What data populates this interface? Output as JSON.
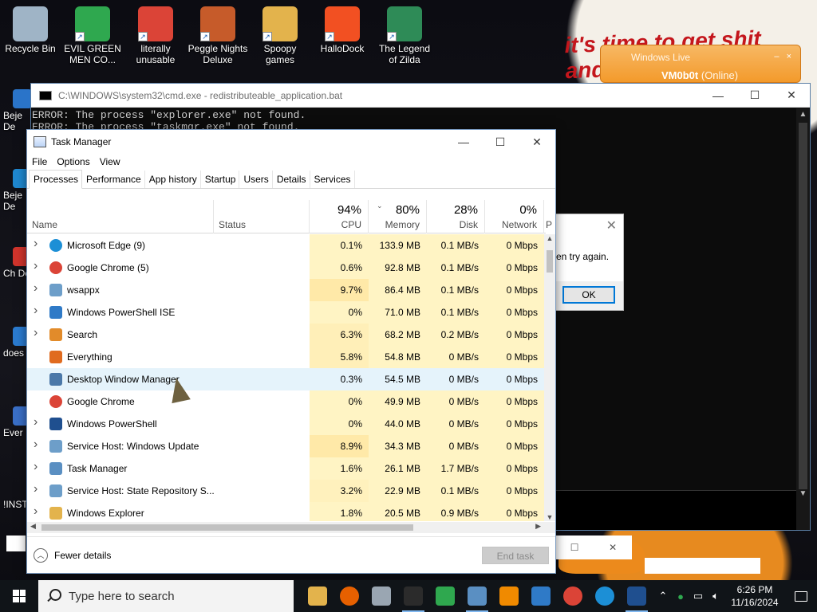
{
  "wallpaper": {
    "meme_text": "it's time to get shit and"
  },
  "desktop_icons": [
    {
      "label": "Recycle Bin",
      "icon": "recycle-bin-icon",
      "color": "#9fb4c6"
    },
    {
      "label": "EVIL GREEN MEN CO...",
      "icon": "msn-buddies-icon",
      "color": "#2fa84f"
    },
    {
      "label": "literally unusable",
      "icon": "chrome-icon",
      "color": "#db4437"
    },
    {
      "label": "Peggle Nights Deluxe",
      "icon": "peggle-icon",
      "color": "#c65b2a"
    },
    {
      "label": "Spoopy games",
      "icon": "folder-icon",
      "color": "#e3b34c"
    },
    {
      "label": "HalloDock",
      "icon": "windows-logo-icon",
      "color": "#f25022"
    },
    {
      "label": "The Legend of Zilda",
      "icon": "zelda-character-icon",
      "color": "#2e8b57"
    }
  ],
  "side_icons": [
    "Beje De",
    "Beje De",
    "Ch De",
    "does",
    "Ever",
    "!INST"
  ],
  "cmd_window": {
    "title": "C:\\WINDOWS\\system32\\cmd.exe - redistributeable_application.bat",
    "lines": [
      "ERROR: The process \"explorer.exe\" not found.",
      "ERROR: The process \"taskmgr.exe\" not found."
    ]
  },
  "wlm_popup": {
    "title": "Windows Live Messenger",
    "title_visible": "Windows Live",
    "username": "VM0b0t",
    "status": "(Online)"
  },
  "error_dialog": {
    "message": "en try again.",
    "ok_label": "OK"
  },
  "task_manager": {
    "title": "Task Manager",
    "menu": [
      "File",
      "Options",
      "View"
    ],
    "tabs": [
      "Processes",
      "Performance",
      "App history",
      "Startup",
      "Users",
      "Details",
      "Services"
    ],
    "active_tab": "Processes",
    "columns": {
      "name": "Name",
      "status": "Status",
      "cpu": {
        "pct": "94%",
        "label": "CPU"
      },
      "memory": {
        "pct": "80%",
        "label": "Memory"
      },
      "disk": {
        "pct": "28%",
        "label": "Disk"
      },
      "network": {
        "pct": "0%",
        "label": "Network"
      },
      "power": "P"
    },
    "processes": [
      {
        "name": "Microsoft Edge (9)",
        "expandable": true,
        "icon": "edge-icon",
        "icon_color": "#1c8fd6",
        "cpu": "0.1%",
        "memory": "133.9 MB",
        "disk": "0.1 MB/s",
        "network": "0 Mbps",
        "cpu_shade": "#fff4c4"
      },
      {
        "name": "Google Chrome (5)",
        "expandable": true,
        "icon": "chrome-icon",
        "icon_color": "#db4437",
        "cpu": "0.6%",
        "memory": "92.8 MB",
        "disk": "0.1 MB/s",
        "network": "0 Mbps",
        "cpu_shade": "#fff4c4"
      },
      {
        "name": "wsappx",
        "expandable": true,
        "icon": "gear-icon",
        "icon_color": "#6d9ec9",
        "cpu": "9.7%",
        "memory": "86.4 MB",
        "disk": "0.1 MB/s",
        "network": "0 Mbps",
        "cpu_shade": "#ffe9a8"
      },
      {
        "name": "Windows PowerShell ISE",
        "expandable": true,
        "icon": "powershell-ise-icon",
        "icon_color": "#2f7ac7",
        "cpu": "0%",
        "memory": "71.0 MB",
        "disk": "0.1 MB/s",
        "network": "0 Mbps",
        "cpu_shade": "#fff4c4"
      },
      {
        "name": "Search",
        "expandable": true,
        "icon": "search-icon",
        "icon_color": "#e28b2a",
        "cpu": "6.3%",
        "memory": "68.2 MB",
        "disk": "0.2 MB/s",
        "network": "0 Mbps",
        "cpu_shade": "#ffefb8"
      },
      {
        "name": "Everything",
        "expandable": false,
        "icon": "magnifier-icon",
        "icon_color": "#e06b1f",
        "cpu": "5.8%",
        "memory": "54.8 MB",
        "disk": "0 MB/s",
        "network": "0 Mbps",
        "cpu_shade": "#ffefb8"
      },
      {
        "name": "Desktop Window Manager",
        "expandable": false,
        "icon": "window-icon",
        "icon_color": "#4b78a8",
        "cpu": "0.3%",
        "memory": "54.5 MB",
        "disk": "0 MB/s",
        "network": "0 Mbps",
        "cpu_shade": "#e5f3fb",
        "highlighted": true
      },
      {
        "name": "Google Chrome",
        "expandable": false,
        "icon": "chrome-icon",
        "icon_color": "#db4437",
        "cpu": "0%",
        "memory": "49.9 MB",
        "disk": "0 MB/s",
        "network": "0 Mbps",
        "cpu_shade": "#fff4c4"
      },
      {
        "name": "Windows PowerShell",
        "expandable": true,
        "icon": "powershell-icon",
        "icon_color": "#1f4f8f",
        "cpu": "0%",
        "memory": "44.0 MB",
        "disk": "0 MB/s",
        "network": "0 Mbps",
        "cpu_shade": "#fff4c4"
      },
      {
        "name": "Service Host: Windows Update",
        "expandable": true,
        "icon": "gear-icon",
        "icon_color": "#6d9ec9",
        "cpu": "8.9%",
        "memory": "34.3 MB",
        "disk": "0 MB/s",
        "network": "0 Mbps",
        "cpu_shade": "#ffe9a8"
      },
      {
        "name": "Task Manager",
        "expandable": true,
        "icon": "task-manager-icon",
        "icon_color": "#5a8fc2",
        "cpu": "1.6%",
        "memory": "26.1 MB",
        "disk": "1.7 MB/s",
        "network": "0 Mbps",
        "cpu_shade": "#fff4c4"
      },
      {
        "name": "Service Host: State Repository S...",
        "expandable": true,
        "icon": "gear-icon",
        "icon_color": "#6d9ec9",
        "cpu": "3.2%",
        "memory": "22.9 MB",
        "disk": "0.1 MB/s",
        "network": "0 Mbps",
        "cpu_shade": "#fff1bd"
      },
      {
        "name": "Windows Explorer",
        "expandable": true,
        "icon": "folder-icon",
        "icon_color": "#e3b34c",
        "cpu": "1.8%",
        "memory": "20.5 MB",
        "disk": "0.9 MB/s",
        "network": "0 Mbps",
        "cpu_shade": "#fff4c4"
      }
    ],
    "fewer_details_label": "Fewer details",
    "end_task_label": "End task"
  },
  "taskbar": {
    "search_placeholder": "Type here to search",
    "apps": [
      {
        "icon": "file-explorer-icon",
        "color": "#e3b34c"
      },
      {
        "icon": "firefox-icon",
        "color": "#e66000"
      },
      {
        "icon": "photos-icon",
        "color": "#9aa6b2"
      },
      {
        "icon": "cmd-icon",
        "color": "#2b2b2b",
        "active": true
      },
      {
        "icon": "msn-buddies-icon",
        "color": "#2fa84f"
      },
      {
        "icon": "task-manager-icon",
        "color": "#5a8fc2",
        "active": true
      },
      {
        "icon": "vlc-icon",
        "color": "#f08a00"
      },
      {
        "icon": "powershell-ise-icon",
        "color": "#2f7ac7"
      },
      {
        "icon": "chrome-icon",
        "color": "#db4437"
      },
      {
        "icon": "edge-icon",
        "color": "#1c8fd6"
      },
      {
        "icon": "powershell-icon",
        "color": "#1f4f8f",
        "active": true
      }
    ],
    "time": "6:26 PM",
    "date": "11/16/2024"
  }
}
